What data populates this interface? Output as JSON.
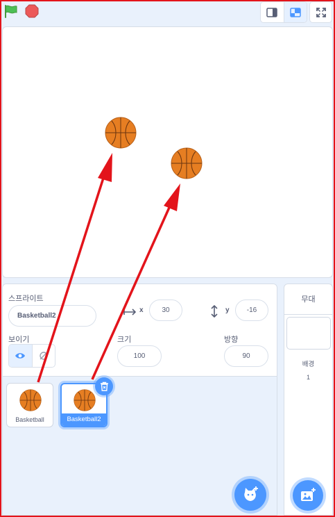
{
  "sprite_info": {
    "sprite_label": "스프라이트",
    "sprite_name": "Basketball2",
    "x_label": "x",
    "x_value": "30",
    "y_label": "y",
    "y_value": "-16",
    "show_label": "보이기",
    "size_label": "크기",
    "size_value": "100",
    "direction_label": "방향",
    "direction_value": "90"
  },
  "sprites": [
    {
      "name": "Basketball",
      "selected": false
    },
    {
      "name": "Basketball2",
      "selected": true
    }
  ],
  "stage_panel": {
    "title": "무대",
    "backdrops_label": "배경",
    "backdrops_count": "1"
  },
  "colors": {
    "accent": "#4c97ff",
    "annotation": "#e3141b",
    "ball": "#e67e22",
    "flag": "#4cbf56",
    "stop": "#ec5959"
  },
  "icons": [
    "green-flag-icon",
    "stop-icon",
    "small-stage-icon",
    "normal-stage-icon",
    "fullscreen-icon",
    "show-icon",
    "hide-icon",
    "delete-icon",
    "add-sprite-icon",
    "add-backdrop-icon"
  ]
}
